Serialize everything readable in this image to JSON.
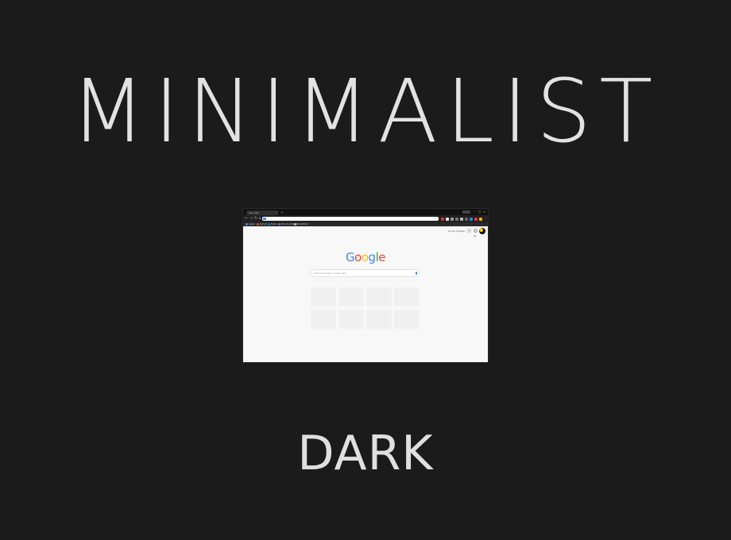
{
  "headline": "MINIMALIST",
  "subline": "DARK",
  "browser": {
    "tab_title": "New Tab",
    "tab_close": "×",
    "new_tab": "+",
    "window_controls": [
      "–",
      "□",
      "×"
    ],
    "nav": {
      "back": "←",
      "forward": "→",
      "reload": "↻",
      "home": "⌂"
    },
    "bookmarks": [
      "Apps",
      "Gmail",
      "Trello",
      "Heroku Portal",
      "DropPilot"
    ],
    "top_links": {
      "gmail": "Gmail",
      "images": "Images"
    },
    "logo_letters": [
      "G",
      "o",
      "o",
      "g",
      "l",
      "e"
    ],
    "logo_colors": [
      "#4285f4",
      "#ea4335",
      "#fbbc05",
      "#4285f4",
      "#34a853",
      "#ea4335"
    ],
    "search_placeholder": "Search Google or type URL",
    "cursor": "↖",
    "colors": {
      "page_bg": "#1b1b1b",
      "chrome_dark": "#202020",
      "content_bg": "#f8f8f8"
    }
  }
}
